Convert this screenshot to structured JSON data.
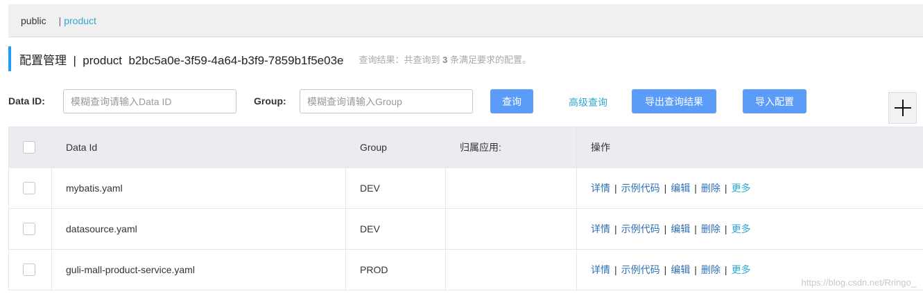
{
  "namespaces": {
    "public": "public",
    "separator": "|",
    "product": "product"
  },
  "title": {
    "text": "配置管理  |  product  b2bc5a0e-3f59-4a64-b3f9-7859b1f5e03e",
    "result_prefix": "查询结果：共查询到",
    "result_count": "3",
    "result_suffix": "条满足要求的配置。"
  },
  "search": {
    "data_id_label": "Data ID:",
    "data_id_placeholder": "模糊查询请输入Data ID",
    "group_label": "Group:",
    "group_placeholder": "模糊查询请输入Group",
    "query_button": "查询",
    "advanced_query": "高级查询",
    "export_button": "导出查询结果",
    "import_button": "导入配置",
    "add_icon": "plus-icon"
  },
  "table": {
    "headers": [
      "Data Id",
      "Group",
      "归属应用:",
      "操作"
    ],
    "rows": [
      {
        "data_id": "mybatis.yaml",
        "group": "DEV",
        "app": ""
      },
      {
        "data_id": "datasource.yaml",
        "group": "DEV",
        "app": ""
      },
      {
        "data_id": "guli-mall-product-service.yaml",
        "group": "PROD",
        "app": ""
      }
    ],
    "actions": {
      "detail": "详情",
      "sample": "示例代码",
      "edit": "编辑",
      "delete": "删除",
      "more": "更多",
      "sep": "|"
    }
  },
  "watermark": "https://blog.csdn.net/Rringo_",
  "colors": {
    "accent_bar": "#209bfa",
    "button": "#5a9cf8",
    "link": "#2fa8d2"
  }
}
